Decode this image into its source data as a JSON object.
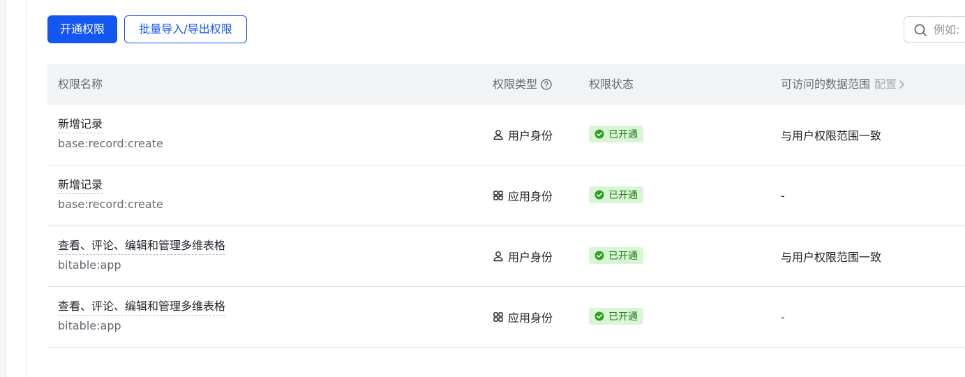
{
  "toolbar": {
    "enable_button_label": "开通权限",
    "batch_button_label": "批量导入/导出权限"
  },
  "search": {
    "placeholder": "例如:"
  },
  "table": {
    "headers": {
      "name": "权限名称",
      "type": "权限类型",
      "status": "权限状态",
      "scope": "可访问的数据范围",
      "scope_config": "配置"
    },
    "rows": [
      {
        "title": "新增记录",
        "key": "base:record:create",
        "type": "用户身份",
        "type_icon": "user-icon",
        "status": "已开通",
        "scope": "与用户权限范围一致"
      },
      {
        "title": "新增记录",
        "key": "base:record:create",
        "type": "应用身份",
        "type_icon": "app-grid-icon",
        "status": "已开通",
        "scope": "-"
      },
      {
        "title": "查看、评论、编辑和管理多维表格",
        "key": "bitable:app",
        "type": "用户身份",
        "type_icon": "user-icon",
        "status": "已开通",
        "scope": "与用户权限范围一致"
      },
      {
        "title": "查看、评论、编辑和管理多维表格",
        "key": "bitable:app",
        "type": "应用身份",
        "type_icon": "app-grid-icon",
        "status": "已开通",
        "scope": "-"
      }
    ]
  },
  "colors": {
    "primary": "#1456f0",
    "status_bg": "#d9f5d6",
    "status_text": "#237b19",
    "header_bg": "#f2f3f5"
  }
}
